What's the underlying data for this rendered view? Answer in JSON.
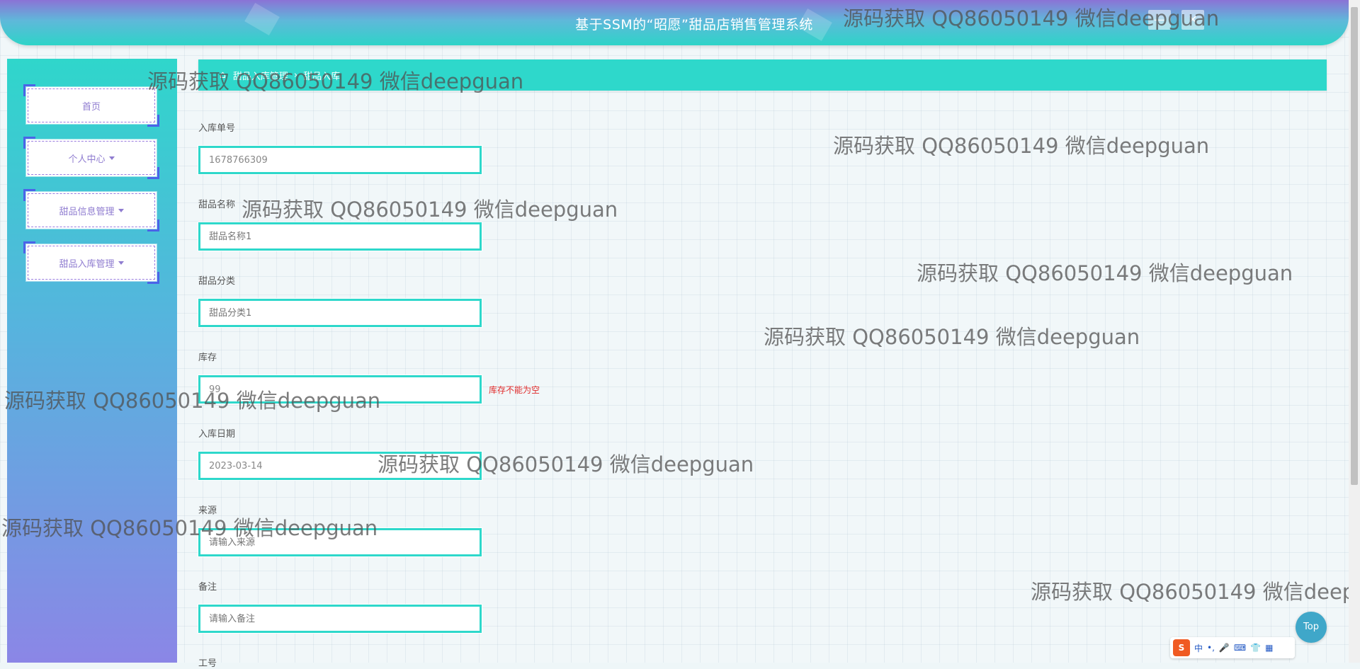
{
  "header": {
    "title": "基于SSM的“昭愿”甜品店销售管理系统",
    "btn_min": "—",
    "btn_close": "✕"
  },
  "sidebar": {
    "items": [
      {
        "label": "首页"
      },
      {
        "label": "个人中心"
      },
      {
        "label": "甜品信息管理"
      },
      {
        "label": "甜品入库管理"
      }
    ]
  },
  "breadcrumb": {
    "home_icon": "⌂",
    "items": [
      "甜品入库管理",
      "甜品入库"
    ],
    "separator": "›"
  },
  "form": {
    "fields": [
      {
        "label": "入库单号",
        "value": "1678766309",
        "placeholder": ""
      },
      {
        "label": "甜品名称",
        "value": "",
        "placeholder": "甜品名称1"
      },
      {
        "label": "甜品分类",
        "value": "",
        "placeholder": "甜品分类1"
      },
      {
        "label": "库存",
        "value": "99",
        "placeholder": ""
      },
      {
        "label": "入库日期",
        "value": "2023-03-14",
        "placeholder": ""
      },
      {
        "label": "来源",
        "value": "",
        "placeholder": "请输入来源"
      },
      {
        "label": "备注",
        "value": "",
        "placeholder": "请输入备注"
      },
      {
        "label": "工号",
        "value": "",
        "placeholder": ""
      }
    ],
    "stock_error": "库存不能为空"
  },
  "top_button": "Top",
  "ime": {
    "logo": "S",
    "items": [
      "中",
      "•,",
      "🎤",
      "⌨",
      "👕",
      "▦"
    ]
  },
  "watermark": "源码获取 QQ86050149 微信deepguan",
  "colors": {
    "accent": "#2ed8cb",
    "menu_text": "#8f7cd0",
    "error": "#e02b2b"
  }
}
